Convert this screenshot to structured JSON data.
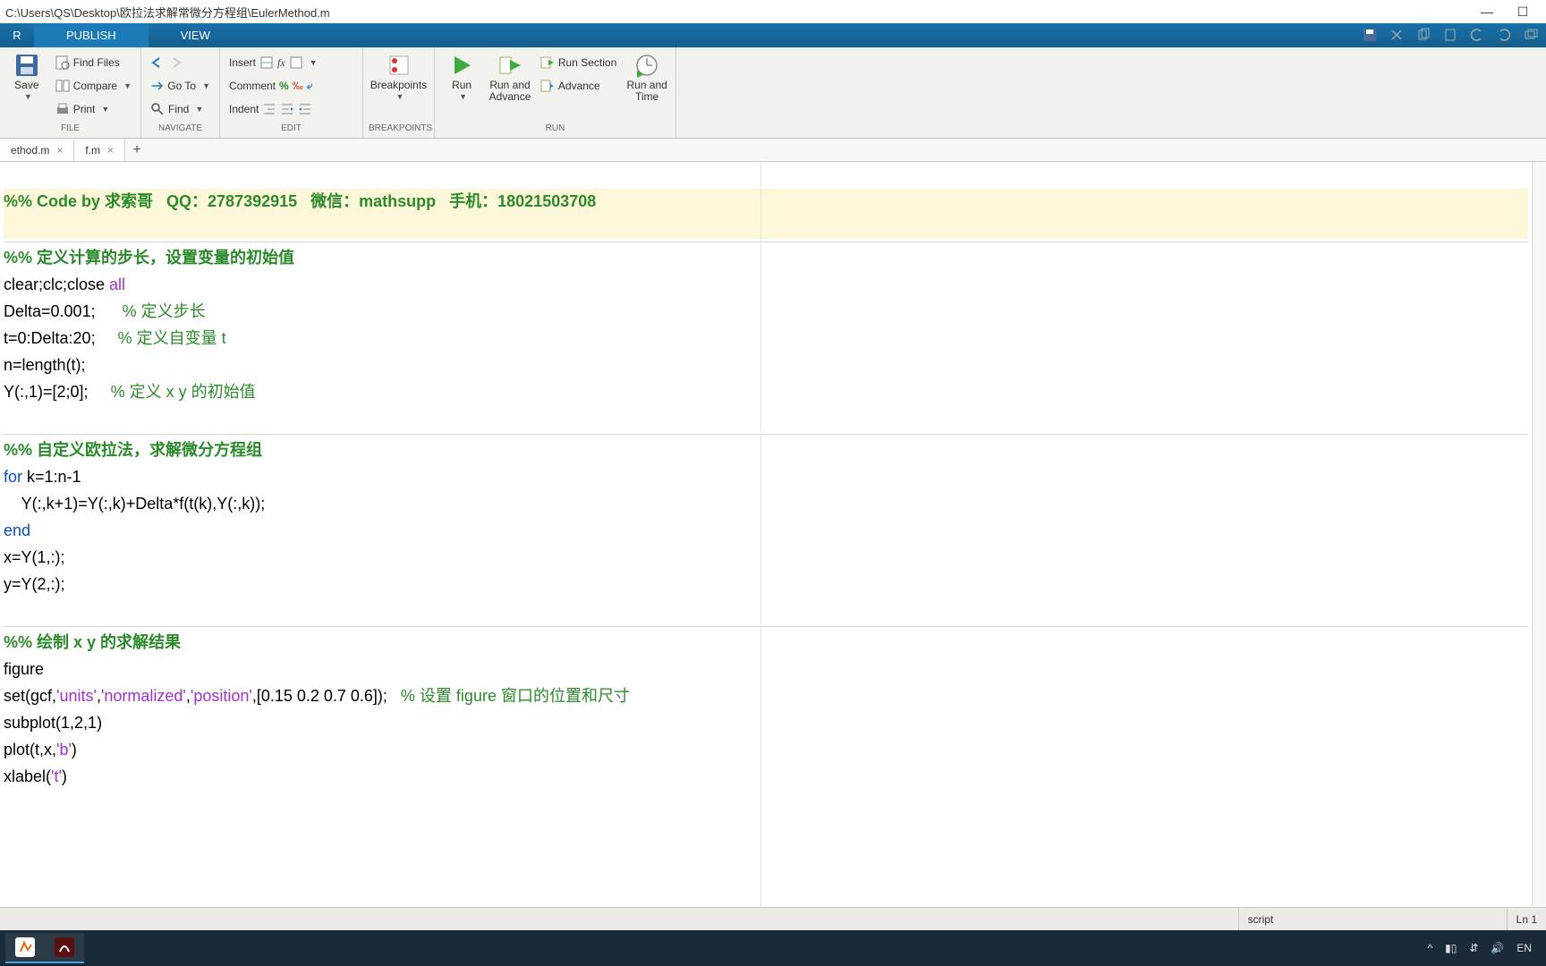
{
  "window": {
    "title": "C:\\Users\\QS\\Desktop\\欧拉法求解常微分方程组\\EulerMethod.m"
  },
  "toolstrip": {
    "corner": "R",
    "tabs": {
      "publish": "PUBLISH",
      "view": "VIEW"
    }
  },
  "ribbon": {
    "file": {
      "save": "Save",
      "find_files": "Find Files",
      "compare": "Compare",
      "print": "Print",
      "group": "FILE"
    },
    "navigate": {
      "goto": "Go To",
      "find": "Find",
      "group": "NAVIGATE"
    },
    "edit": {
      "insert": "Insert",
      "comment": "Comment",
      "indent": "Indent",
      "group": "EDIT"
    },
    "breakpoints": {
      "label": "Breakpoints",
      "group": "BREAKPOINTS"
    },
    "run": {
      "run": "Run",
      "run_advance": "Run and\nAdvance",
      "run_section": "Run Section",
      "advance": "Advance",
      "run_time": "Run and\nTime",
      "group": "RUN"
    }
  },
  "tabs": {
    "t1": "ethod.m",
    "t2": "f.m"
  },
  "code": {
    "l1": "%% Code by 求索哥   QQ：2787392915   微信：mathsupp   手机：18021503708",
    "l2_cell": "%% 定义计算的步长，设置变量的初始值",
    "l3a": "clear;clc;close ",
    "l3b": "all",
    "l4a": "Delta=0.001;      ",
    "l4b": "% 定义步长",
    "l5a": "t=0:Delta:20;     ",
    "l5b": "% 定义自变量 t",
    "l6": "n=length(t);",
    "l7a": "Y(:,1)=[2;0];     ",
    "l7b": "% 定义 x y 的初始值",
    "l8_cell": "%% 自定义欧拉法，求解微分方程组",
    "l9a": "for",
    "l9b": " k=1:n-1",
    "l10": "    Y(:,k+1)=Y(:,k)+Delta*f(t(k),Y(:,k));",
    "l11": "end",
    "l12": "x=Y(1,:);",
    "l13": "y=Y(2,:);",
    "l14_cell": "%% 绘制 x y 的求解结果",
    "l15": "figure",
    "l16a": "set(gcf,",
    "l16b": "'units'",
    "l16c": ",",
    "l16d": "'normalized'",
    "l16e": ",",
    "l16f": "'position'",
    "l16g": ",[0.15 0.2 0.7 0.6]);   ",
    "l16h": "% 设置 figure 窗口的位置和尺寸",
    "l17": "subplot(1,2,1)",
    "l18a": "plot(t,x,",
    "l18b": "'b'",
    "l18c": ")",
    "l19a": "xlabel(",
    "l19b": "'t'",
    "l19c": ")"
  },
  "status": {
    "type": "script",
    "pos": "Ln  1"
  },
  "tray": {
    "lang": "EN"
  }
}
